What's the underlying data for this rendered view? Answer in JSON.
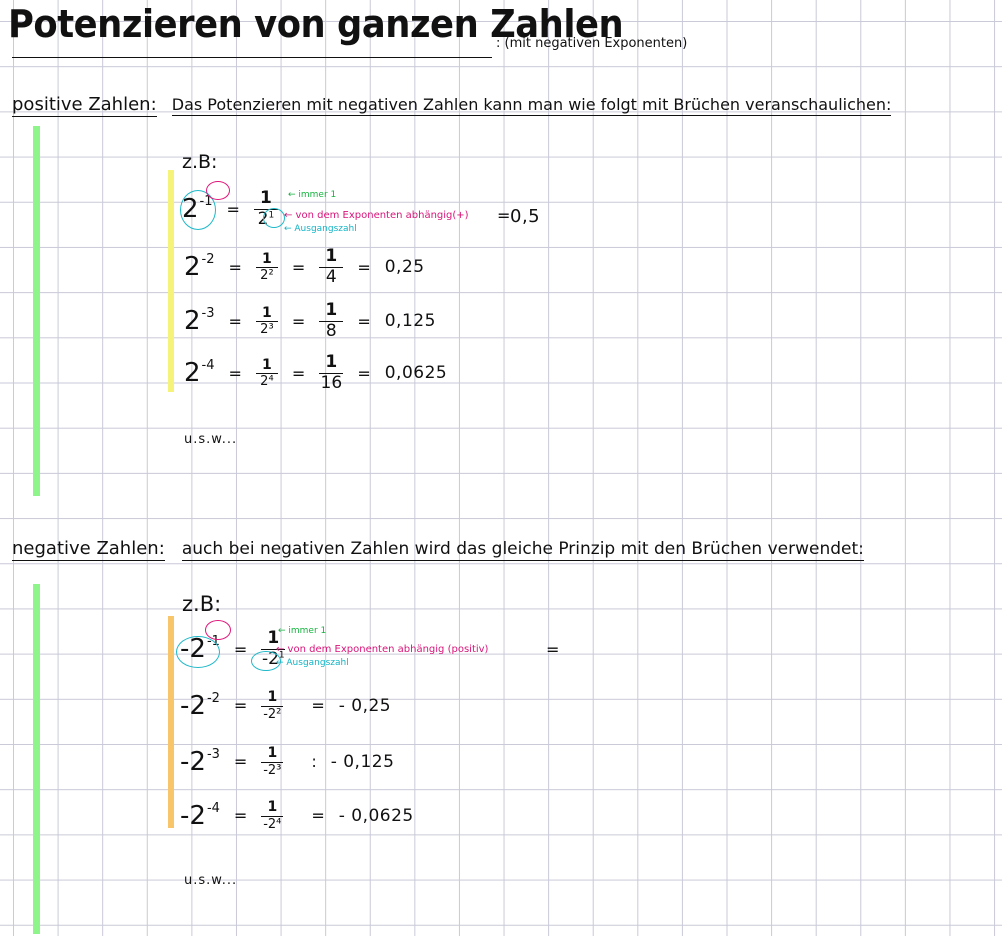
{
  "title": {
    "main": "Potenzieren von ganzen Zahlen",
    "note": ": (mit negativen Exponenten)"
  },
  "positive": {
    "heading": "positive Zahlen:",
    "text": "Das Potenzieren mit negativen Zahlen kann man wie folgt mit Brüchen veranschaulichen:",
    "zb": "z.B:",
    "rows": [
      {
        "base": "2",
        "exp": "-1",
        "frac_num": "1",
        "frac_den": "2",
        "frac_den_exp": "1",
        "result": "0,5"
      },
      {
        "base": "2",
        "exp": "-2",
        "frac1_num": "1",
        "frac1_den": "2²",
        "frac2_num": "1",
        "frac2_den": "4",
        "result": "0,25"
      },
      {
        "base": "2",
        "exp": "-3",
        "frac1_num": "1",
        "frac1_den": "2³",
        "frac2_num": "1",
        "frac2_den": "8",
        "result": "0,125"
      },
      {
        "base": "2",
        "exp": "-4",
        "frac1_num": "1",
        "frac1_den": "2⁴",
        "frac2_num": "1",
        "frac2_den": "16",
        "result": "0,0625"
      }
    ],
    "annotations": {
      "immer": "← immer 1",
      "exponent": "← von dem Exponenten abhängig(+)",
      "ausgang": "← Ausgangszahl"
    },
    "usw": "u.s.w..."
  },
  "negative": {
    "heading": "negative Zahlen:",
    "text": "auch bei negativen Zahlen wird das gleiche Prinzip mit den Brüchen verwendet:",
    "zb": "z.B:",
    "rows": [
      {
        "base": "-2",
        "exp": "-1",
        "frac_num": "1",
        "frac_den": "-2",
        "frac_den_exp": "1",
        "result": ""
      },
      {
        "base": "-2",
        "exp": "-2",
        "frac_num": "1",
        "frac_den": "-2²",
        "result": "- 0,25"
      },
      {
        "base": "-2",
        "exp": "-3",
        "frac_num": "1",
        "frac_den": "-2³",
        "result": "- 0,125"
      },
      {
        "base": "-2",
        "exp": "-4",
        "frac_num": "1",
        "frac_den": "-2⁴",
        "result": "- 0,0625"
      }
    ],
    "annotations": {
      "immer": "← immer 1",
      "exponent": "← von dem Exponenten abhängig (positiv)",
      "ausgang": "← Ausgangszahl"
    },
    "usw": "u.s.w..."
  },
  "colors": {
    "green_bar": "#8ef58a",
    "yellow_bar": "#f6f37a",
    "orange_bar": "#f8c56a",
    "cyan": "#1fb9c9",
    "magenta": "#e0167a",
    "annotation_green": "#15b33f"
  }
}
